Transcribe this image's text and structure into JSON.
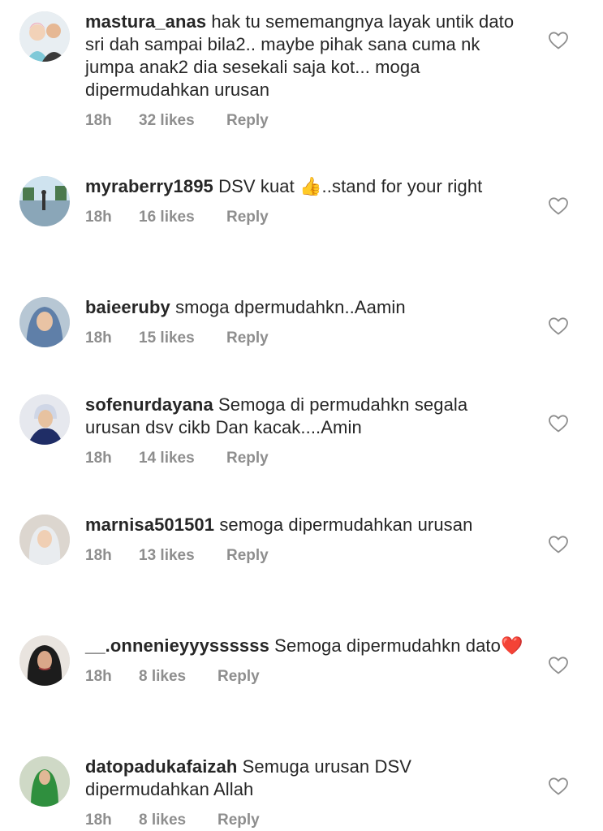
{
  "comments": [
    {
      "username": "mastura_anas",
      "text": "hak tu sememangnya layak untik dato sri dah sampai bila2.. maybe pihak sana cuma nk jumpa anak2 dia sesekali saja kot... moga dipermudahkan urusan",
      "emoji": "",
      "time": "18h",
      "likes": "32 likes",
      "reply": "Reply"
    },
    {
      "username": "myraberry1895",
      "text": "DSV kuat ",
      "emoji": "👍",
      "text_after": "..stand for your right",
      "time": "18h",
      "likes": "16 likes",
      "reply": "Reply"
    },
    {
      "username": "baieeruby",
      "text": "smoga dpermudahkn..Aamin",
      "emoji": "",
      "time": "18h",
      "likes": "15 likes",
      "reply": "Reply"
    },
    {
      "username": "sofenurdayana",
      "text": "Semoga di permudahkn segala urusan dsv cikb Dan kacak....Amin",
      "emoji": "",
      "time": "18h",
      "likes": "14 likes",
      "reply": "Reply"
    },
    {
      "username": "marnisa501501",
      "text": "semoga dipermudahkan urusan",
      "emoji": "",
      "time": "18h",
      "likes": "13 likes",
      "reply": "Reply"
    },
    {
      "username": "__.onnenieyyyssssss",
      "text": "Semoga dipermudahkn dato",
      "emoji": "❤️",
      "time": "18h",
      "likes": "8 likes",
      "reply": "Reply"
    },
    {
      "username": "datopadukafaizah",
      "text": "Semuga urusan DSV dipermudahkan Allah",
      "emoji": "",
      "time": "18h",
      "likes": "8 likes",
      "reply": "Reply"
    }
  ],
  "colors": {
    "text": "#262626",
    "meta": "#8e8e8e",
    "heart_stroke": "#8e8e8e"
  },
  "icons": {
    "like": "heart-outline-icon",
    "avatar": "profile-photo"
  }
}
